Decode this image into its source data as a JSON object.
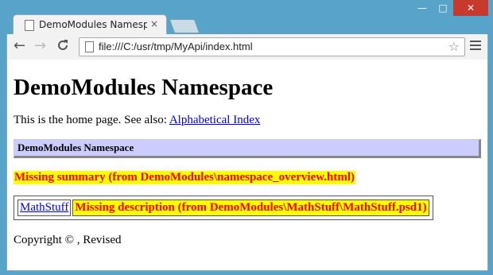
{
  "window": {
    "minimize_glyph": "—",
    "maximize_glyph": "□",
    "close_glyph": "✕"
  },
  "tab": {
    "title": "DemoModules Namespac",
    "close_glyph": "×"
  },
  "toolbar": {
    "back_glyph": "←",
    "forward_glyph": "→",
    "reload_glyph": "C",
    "url": "file:///C:/usr/tmp/MyApi/index.html",
    "star_glyph": "☆"
  },
  "page": {
    "heading": "DemoModules Namespace",
    "intro_text": "This is the home page. See also: ",
    "intro_link": "Alphabetical Index",
    "section_title": "DemoModules Namespace",
    "missing_summary": "Missing summary (from DemoModules\\namespace_overview.html)",
    "modules": [
      {
        "name": "MathStuff",
        "description": "Missing description (from DemoModules\\MathStuff\\MathStuff.psd1)"
      }
    ],
    "copyright": "Copyright © , Revised"
  },
  "colors": {
    "section_bg": "#ccccff",
    "missing_bg": "#ffff00",
    "missing_fg": "#ff0000",
    "link": "#0000ee",
    "close_button": "#c7392d"
  }
}
